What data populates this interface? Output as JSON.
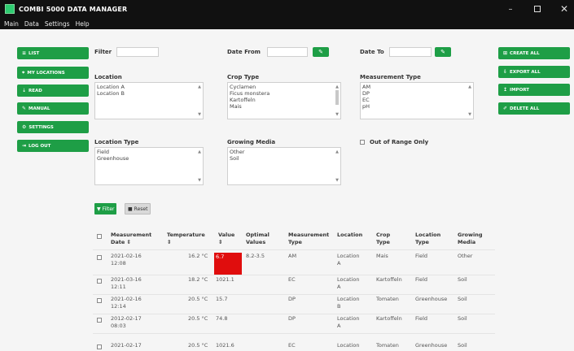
{
  "window": {
    "title": "COMBI 5000 DATA MANAGER",
    "controls": [
      "–",
      "",
      "✕"
    ]
  },
  "menu": [
    "Main",
    "Data",
    "Settings",
    "Help"
  ],
  "sidebar": [
    {
      "label": "LIST",
      "icon": "list-icon",
      "glyph": "≡"
    },
    {
      "label": "MY LOCATIONS",
      "icon": "location-icon",
      "glyph": "⌖"
    },
    {
      "label": "READ",
      "icon": "read-icon",
      "glyph": "⇣"
    },
    {
      "label": "MANUAL",
      "icon": "manual-icon",
      "glyph": "✎"
    },
    {
      "label": "SETTINGS",
      "icon": "gear-icon",
      "glyph": "⚙"
    },
    {
      "label": "LOG OUT",
      "icon": "logout-icon",
      "glyph": "⇥"
    }
  ],
  "actions": [
    {
      "label": "CREATE ALL",
      "icon": "create-icon",
      "glyph": "⊞"
    },
    {
      "label": "EXPORT ALL",
      "icon": "export-icon",
      "glyph": "⇩"
    },
    {
      "label": "IMPORT",
      "icon": "import-icon",
      "glyph": "↥"
    },
    {
      "label": "DELETE ALL",
      "icon": "delete-icon",
      "glyph": "✐"
    }
  ],
  "filters": {
    "filter_label": "Filter",
    "date_from_label": "Date From",
    "date_to_label": "Date To",
    "location": {
      "label": "Location",
      "items": [
        "Location A",
        "Location B"
      ]
    },
    "crop_type": {
      "label": "Crop Type",
      "items": [
        "Cyclamen",
        "Ficus monstera",
        "Kartoffeln",
        "Mais"
      ]
    },
    "measurement_type": {
      "label": "Measurement Type",
      "items": [
        "AM",
        "DP",
        "EC",
        "pH"
      ]
    },
    "location_type": {
      "label": "Location Type",
      "items": [
        "Field",
        "Greenhouse"
      ]
    },
    "growing_media": {
      "label": "Growing Media",
      "items": [
        "Other",
        "Soil"
      ]
    },
    "out_of_range_label": "Out of Range Only",
    "filter_button": "Filter",
    "reset_button": "Reset"
  },
  "table": {
    "headers": [
      [
        "Measurement",
        "Date ⇕"
      ],
      [
        "Temperature",
        "⇕"
      ],
      [
        "Value",
        "⇕"
      ],
      [
        "Optimal",
        "Values"
      ],
      [
        "Measurement",
        "Type"
      ],
      [
        "Location"
      ],
      [
        "Crop",
        "Type"
      ],
      [
        "Location",
        "Type"
      ],
      [
        "Growing",
        "Media"
      ]
    ],
    "rows": [
      {
        "date": [
          "2021-02-16",
          "12:08"
        ],
        "temp": "16.2 °C",
        "value": "6.7",
        "optimal": "8.2-3.5",
        "mtype": "AM",
        "loc": [
          "Location",
          "A"
        ],
        "crop": "Mais",
        "ltype": "Field",
        "media": "Other",
        "alert": true
      },
      {
        "date": [
          "2021-03-16",
          "12:11"
        ],
        "temp": "18.2 °C",
        "value": "1021.1",
        "optimal": "",
        "mtype": "EC",
        "loc": [
          "Location",
          "A"
        ],
        "crop": "Kartoffeln",
        "ltype": "Field",
        "media": "Soil",
        "alert": false
      },
      {
        "date": [
          "2021-02-16",
          "12:14"
        ],
        "temp": "20.5 °C",
        "value": "15.7",
        "optimal": "",
        "mtype": "DP",
        "loc": [
          "Location",
          "B"
        ],
        "crop": "Tomaten",
        "ltype": "Greenhouse",
        "media": "Soil",
        "alert": false
      },
      {
        "date": [
          "2012-02-17",
          "08:03"
        ],
        "temp": "20.5 °C",
        "value": "74.8",
        "optimal": "",
        "mtype": "DP",
        "loc": [
          "Location",
          "A"
        ],
        "crop": "Kartoffeln",
        "ltype": "Field",
        "media": "Soil",
        "alert": false
      },
      {
        "date": [
          "2021-02-17",
          ""
        ],
        "temp": "20.5 °C",
        "value": "1021.6",
        "optimal": "",
        "mtype": "EC",
        "loc": [
          "Location",
          ""
        ],
        "crop": "Tomaten",
        "ltype": "Greenhouse",
        "media": "Soil",
        "alert": false
      }
    ]
  }
}
